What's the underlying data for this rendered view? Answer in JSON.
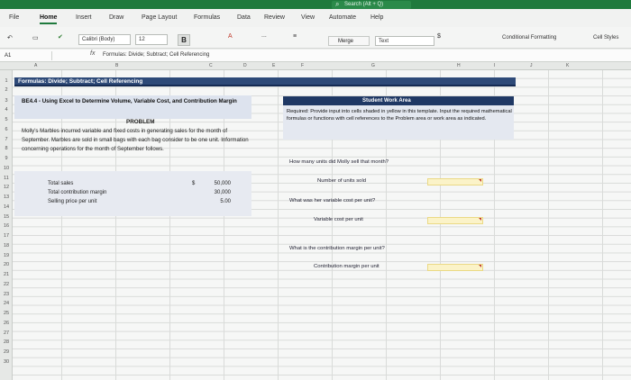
{
  "search": {
    "placeholder": "Search (Alt + Q)"
  },
  "tabs": [
    "File",
    "Home",
    "Insert",
    "Draw",
    "Page Layout",
    "Formulas",
    "Data",
    "Review",
    "View",
    "Automate",
    "Help"
  ],
  "ribbon": {
    "font_name": "Calibri (Body)",
    "font_size": "12",
    "bold": "B",
    "more": "...",
    "merge_label": "Merge",
    "number_format": "Text",
    "currency": "$",
    "conditional_formatting": "Conditional Formatting",
    "cell_styles": "Cell Styles"
  },
  "formula_bar": {
    "name_box": "A1",
    "fx": "fx",
    "formula": "Formulas: Divide; Subtract; Cell Referencing"
  },
  "columns": [
    "A",
    "B",
    "C",
    "D",
    "E",
    "F",
    "G",
    "H",
    "I",
    "J",
    "K"
  ],
  "rows": [
    "1",
    "2",
    "3",
    "4",
    "5",
    "6",
    "7",
    "8",
    "9",
    "10",
    "11",
    "12",
    "13",
    "14",
    "15",
    "16",
    "17",
    "18",
    "19",
    "20",
    "21",
    "22",
    "23",
    "24",
    "25",
    "26",
    "27",
    "28",
    "29",
    "30"
  ],
  "sheet": {
    "title_band": "Formulas: Divide; Subtract; Cell Referencing",
    "section_title": "BE4.4 - Using Excel to Determine Volume, Variable Cost, and Contribution Margin",
    "problem_heading": "PROBLEM",
    "problem_text": "Molly's Marbles incurred variable and fixed costs in generating sales for the month of September. Marbles are sold in small bags with each bag consider to be one unit. Information concerning operations for the month of September follows.",
    "data": [
      {
        "label": "Total sales",
        "symbol": "$",
        "value": "50,000"
      },
      {
        "label": "Total contribution margin",
        "symbol": "",
        "value": "30,000"
      },
      {
        "label": "Selling price per unit",
        "symbol": "",
        "value": "5.00"
      }
    ],
    "student_area": {
      "header": "Student Work Area",
      "required": "Required: Provide input into cells shaded in yellow in this template. Input the required mathematical formulas or functions with cell references to the Problem area or work area as indicated.",
      "questions": [
        {
          "question": "How many units did Molly sell that month?",
          "input_label": "Number of units sold"
        },
        {
          "question": "What was her variable cost per unit?",
          "input_label": "Variable cost per unit"
        },
        {
          "question": "What is the contribution margin per unit?",
          "input_label": "Contribution margin per unit"
        }
      ]
    }
  }
}
